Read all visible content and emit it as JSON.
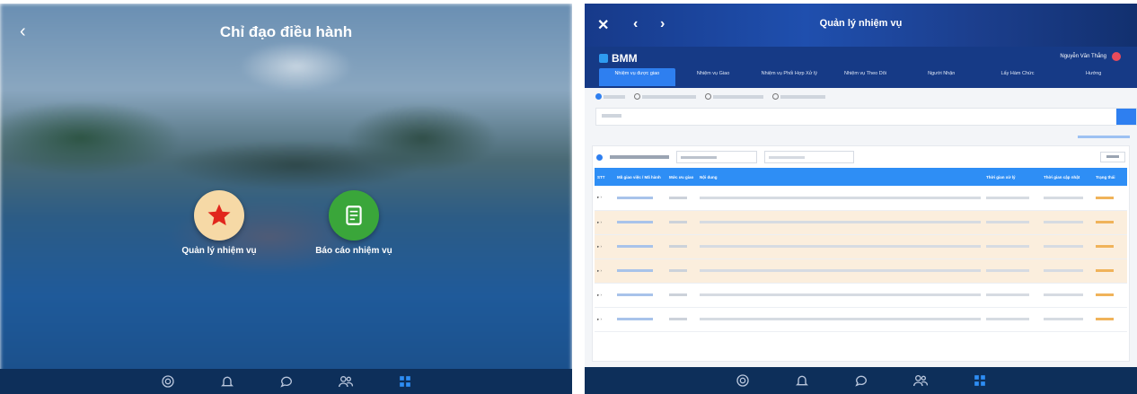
{
  "left": {
    "title": "Chỉ đạo điều hành",
    "apps": [
      {
        "label": "Quản lý nhiệm vụ",
        "icon": "star-icon",
        "color": "#f6d9a6"
      },
      {
        "label": "Báo cáo nhiệm vụ",
        "icon": "report-icon",
        "color": "#3aa63a"
      }
    ]
  },
  "right": {
    "title": "Quản lý nhiệm vụ",
    "brand": "BMM",
    "user_name": "Nguyễn Văn Thắng",
    "tabs": [
      "Nhiệm vụ được giao",
      "Nhiệm vụ Giao",
      "Nhiệm vụ Phối Hợp Xử lý",
      "Nhiệm vụ Theo Dõi",
      "Người Nhận",
      "Lấy Hàm Chức",
      "Hướng"
    ],
    "table": {
      "headers": [
        "STT",
        "Mã giao việc / Mã hành",
        "Mức ưu giao",
        "Nội dung",
        "Thời gian xử lý",
        "Thời gian cập nhật",
        "Trạng thái"
      ]
    },
    "icons": {
      "close": "✕",
      "back": "‹",
      "forward": "›"
    }
  },
  "nav": [
    "home-icon",
    "bell-icon",
    "chat-icon",
    "users-icon",
    "apps-icon"
  ],
  "colors": {
    "accent": "#2e8ef5",
    "nav_bg": "#0d2f5a",
    "header_bg": "#163a86"
  }
}
